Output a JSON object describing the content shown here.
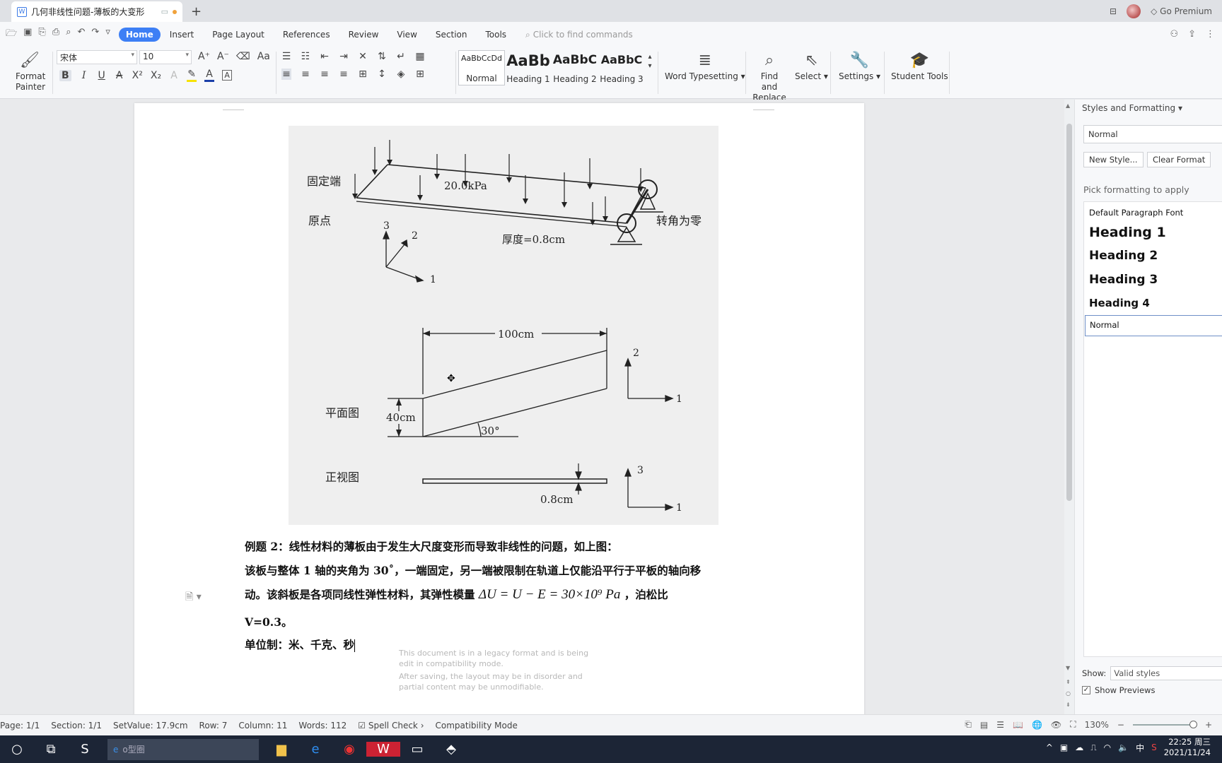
{
  "titlebar": {
    "doc_title": "几何非线性问题-薄板的大变形",
    "go_premium": "Go Premium"
  },
  "menu": {
    "items": [
      "Home",
      "Insert",
      "Page Layout",
      "References",
      "Review",
      "View",
      "Section",
      "Tools"
    ],
    "find_placeholder": "Click to find commands"
  },
  "ribbon": {
    "format_painter": "Format Painter",
    "font_name": "宋体",
    "font_size": "10",
    "styles": [
      {
        "preview": "AaBbCcDd",
        "name": "Normal"
      },
      {
        "preview": "AaBb",
        "name": "Heading 1"
      },
      {
        "preview": "AaBbC",
        "name": "Heading 2"
      },
      {
        "preview": "AaBbC",
        "name": "Heading 3"
      }
    ],
    "word_typesetting": "Word Typesetting",
    "find_replace": "Find and Replace",
    "select": "Select",
    "settings": "Settings",
    "student_tools": "Student Tools"
  },
  "figure": {
    "fixed_end": "固定端",
    "load": "20.0kPa",
    "origin": "原点",
    "rotation_zero": "转角为零",
    "thickness": "厚度=0.8cm",
    "axis_1": "1",
    "axis_2": "2",
    "axis_3": "3",
    "length": "100cm",
    "width": "40cm",
    "angle": "30°",
    "plan_view": "平面图",
    "front_view": "正视图",
    "plate_thickness": "0.8cm"
  },
  "document": {
    "p1": "例题 2：线性材料的薄板由于发生大尺度变形而导致非线性的问题，如上图：",
    "p2": "该板与整体 1 轴的夹角为 30˚，一端固定，另一端被限制在轨道上仅能沿平行于平板的轴向移",
    "p3a": "动。该斜板是各项同线性弹性材料，其弹性模量",
    "p3math": "ΔU = U − E = 30×10⁹ Pa",
    "p3b": "，泊松比",
    "p4": "V=0.3。",
    "p5": "单位制：米、千克、秒",
    "compat_1": "This document is in a legacy format and is being edit in compatibility mode.",
    "compat_2": "After saving, the layout may be in disorder and partial content may be unmodifiable."
  },
  "pane": {
    "title": "Styles and Formatting",
    "current": "Normal",
    "new_style": "New Style...",
    "clear_format": "Clear Format",
    "pick_label": "Pick formatting to apply",
    "items": [
      "Default Paragraph Font",
      "Heading 1",
      "Heading 2",
      "Heading 3",
      "Heading 4",
      "Normal"
    ],
    "show_label": "Show:",
    "show_value": "Valid styles",
    "show_previews": "Show Previews"
  },
  "status": {
    "page": "Page: 1/1",
    "section": "Section: 1/1",
    "setvalue": "SetValue: 17.9cm",
    "row": "Row: 7",
    "column": "Column: 11",
    "words": "Words: 112",
    "spell": "Spell Check",
    "mode": "Compatibility Mode",
    "zoom": "130%"
  },
  "taskbar": {
    "search_placeholder": "o型圈",
    "ime": "中",
    "time": "22:25 周三",
    "date": "2021/11/24"
  }
}
